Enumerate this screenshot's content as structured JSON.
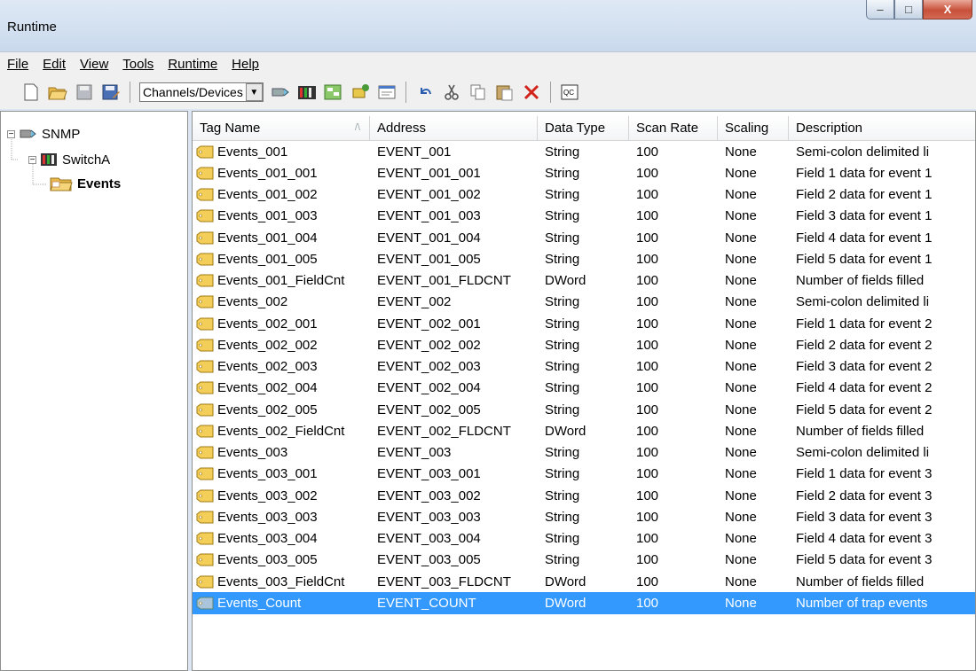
{
  "window": {
    "title": "Runtime",
    "min": "–",
    "max": "□",
    "close": "X"
  },
  "menu": [
    "File",
    "Edit",
    "View",
    "Tools",
    "Runtime",
    "Help"
  ],
  "toolbar": {
    "selector_value": "Channels/Devices"
  },
  "tree": {
    "channel": "SNMP",
    "device": "SwitchA",
    "group": "Events"
  },
  "columns": [
    "Tag Name",
    "Address",
    "Data Type",
    "Scan Rate",
    "Scaling",
    "Description"
  ],
  "rows": [
    [
      "Events_001",
      "EVENT_001",
      "String",
      "100",
      "None",
      "Semi-colon delimited li"
    ],
    [
      "Events_001_001",
      "EVENT_001_001",
      "String",
      "100",
      "None",
      "Field 1 data for event 1"
    ],
    [
      "Events_001_002",
      "EVENT_001_002",
      "String",
      "100",
      "None",
      "Field 2 data for event 1"
    ],
    [
      "Events_001_003",
      "EVENT_001_003",
      "String",
      "100",
      "None",
      "Field 3 data for event 1"
    ],
    [
      "Events_001_004",
      "EVENT_001_004",
      "String",
      "100",
      "None",
      "Field 4 data for event 1"
    ],
    [
      "Events_001_005",
      "EVENT_001_005",
      "String",
      "100",
      "None",
      "Field 5 data for event 1"
    ],
    [
      "Events_001_FieldCnt",
      "EVENT_001_FLDCNT",
      "DWord",
      "100",
      "None",
      "Number of fields filled"
    ],
    [
      "Events_002",
      "EVENT_002",
      "String",
      "100",
      "None",
      "Semi-colon delimited li"
    ],
    [
      "Events_002_001",
      "EVENT_002_001",
      "String",
      "100",
      "None",
      "Field 1 data for event 2"
    ],
    [
      "Events_002_002",
      "EVENT_002_002",
      "String",
      "100",
      "None",
      "Field 2 data for event 2"
    ],
    [
      "Events_002_003",
      "EVENT_002_003",
      "String",
      "100",
      "None",
      "Field 3 data for event 2"
    ],
    [
      "Events_002_004",
      "EVENT_002_004",
      "String",
      "100",
      "None",
      "Field 4 data for event 2"
    ],
    [
      "Events_002_005",
      "EVENT_002_005",
      "String",
      "100",
      "None",
      "Field 5 data for event 2"
    ],
    [
      "Events_002_FieldCnt",
      "EVENT_002_FLDCNT",
      "DWord",
      "100",
      "None",
      "Number of fields filled"
    ],
    [
      "Events_003",
      "EVENT_003",
      "String",
      "100",
      "None",
      "Semi-colon delimited li"
    ],
    [
      "Events_003_001",
      "EVENT_003_001",
      "String",
      "100",
      "None",
      "Field 1 data for event 3"
    ],
    [
      "Events_003_002",
      "EVENT_003_002",
      "String",
      "100",
      "None",
      "Field 2 data for event 3"
    ],
    [
      "Events_003_003",
      "EVENT_003_003",
      "String",
      "100",
      "None",
      "Field 3 data for event 3"
    ],
    [
      "Events_003_004",
      "EVENT_003_004",
      "String",
      "100",
      "None",
      "Field 4 data for event 3"
    ],
    [
      "Events_003_005",
      "EVENT_003_005",
      "String",
      "100",
      "None",
      "Field 5 data for event 3"
    ],
    [
      "Events_003_FieldCnt",
      "EVENT_003_FLDCNT",
      "DWord",
      "100",
      "None",
      "Number of fields filled"
    ],
    [
      "Events_Count",
      "EVENT_COUNT",
      "DWord",
      "100",
      "None",
      "Number of trap events"
    ]
  ],
  "selected_row": 21
}
